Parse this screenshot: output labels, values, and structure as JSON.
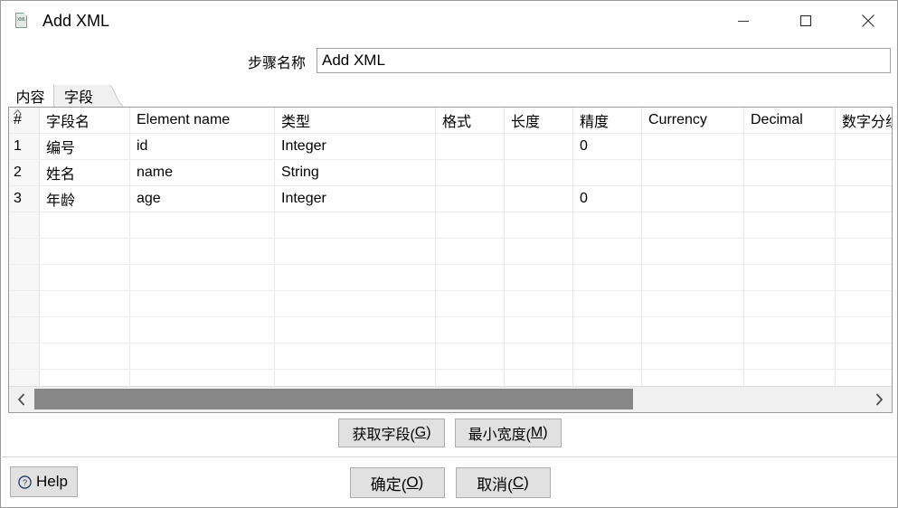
{
  "window": {
    "title": "Add XML",
    "icon": "xml-file-icon",
    "controls": {
      "minimize": "minimize-icon",
      "maximize": "maximize-icon",
      "close": "close-icon"
    }
  },
  "step": {
    "label": "步骤名称",
    "value": "Add XML",
    "placeholder": ""
  },
  "tabs": [
    {
      "label": "内容",
      "active": false
    },
    {
      "label": "字段",
      "active": true
    }
  ],
  "table": {
    "headers": [
      "#",
      "字段名",
      "Element name",
      "类型",
      "格式",
      "长度",
      "精度",
      "Currency",
      "Decimal",
      "数字分组符号"
    ],
    "sort_indicator": "caret-up-icon",
    "rows": [
      {
        "num": "1",
        "field_name": "编号",
        "element_name": "id",
        "type": "Integer",
        "format": "",
        "length": "",
        "precision": "0",
        "currency": "",
        "decimal": "",
        "grouping": ""
      },
      {
        "num": "2",
        "field_name": "姓名",
        "element_name": "name",
        "type": "String",
        "format": "",
        "length": "",
        "precision": "",
        "currency": "",
        "decimal": "",
        "grouping": ""
      },
      {
        "num": "3",
        "field_name": "年龄",
        "element_name": "age",
        "type": "Integer",
        "format": "",
        "length": "",
        "precision": "0",
        "currency": "",
        "decimal": "",
        "grouping": ""
      }
    ],
    "empty_row_count": 7,
    "scrollbar": {
      "left_arrow": "chevron-left-icon",
      "right_arrow": "chevron-right-icon",
      "thumb_start_pct": 0,
      "thumb_width_pct": 72
    }
  },
  "mid_buttons": [
    {
      "name": "get-fields-button",
      "text_before": "获取字段( ",
      "mnemonic": "G",
      "text_after": ")"
    },
    {
      "name": "minimal-width-button",
      "text_before": "最小宽度(",
      "mnemonic": "M",
      "text_after": ")"
    }
  ],
  "footer": {
    "help": {
      "label": "Help",
      "icon": "help-circle-icon"
    },
    "ok": {
      "text_before": "确定(",
      "mnemonic": "O",
      "text_after": ")"
    },
    "cancel": {
      "text_before": "取消(",
      "mnemonic": "C",
      "text_after": ")"
    }
  },
  "colors": {
    "window_border": "#9a9a9a",
    "button_face": "#e1e1e1",
    "button_border": "#adadad",
    "scroll_thumb": "#878787",
    "row_number_bg": "#f7f7f7",
    "active_tab_bg": "#f0f0f0",
    "help_icon": "#1f3864"
  }
}
